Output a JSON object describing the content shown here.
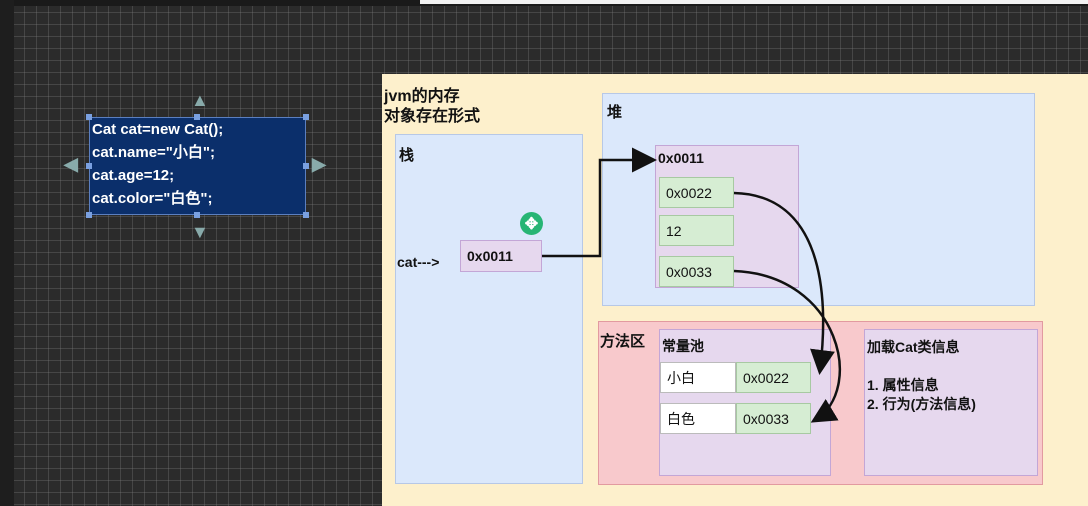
{
  "code": {
    "lines": [
      "Cat cat=new Cat();",
      "cat.name=\"小白\";",
      "cat.age=12;",
      "cat.color=\"白色\";"
    ]
  },
  "diagram": {
    "title_line1": "jvm的内存",
    "title_line2": "对象存在形式",
    "stack": {
      "label": "栈",
      "var_label": "cat--->",
      "ref": "0x0011"
    },
    "heap": {
      "label": "堆",
      "object_addr": "0x0011",
      "fields": [
        "0x0022",
        "12",
        "0x0033"
      ]
    },
    "method_area": {
      "label": "方法区",
      "const_pool": {
        "label": "常量池",
        "entries": [
          {
            "value": "小白",
            "addr": "0x0022"
          },
          {
            "value": "白色",
            "addr": "0x0033"
          }
        ]
      },
      "class_info": {
        "label": "加载Cat类信息",
        "items": [
          "1. 属性信息",
          "2. 行为(方法信息)"
        ]
      }
    }
  },
  "colors": {
    "code_bg": "#0b2f6b",
    "panel_bg": "#fdf0cc",
    "region_blue": "#dbe8fb",
    "region_pink": "#f8c9cc",
    "object_purple": "#e6d8ee",
    "field_green": "#d6edd3"
  }
}
